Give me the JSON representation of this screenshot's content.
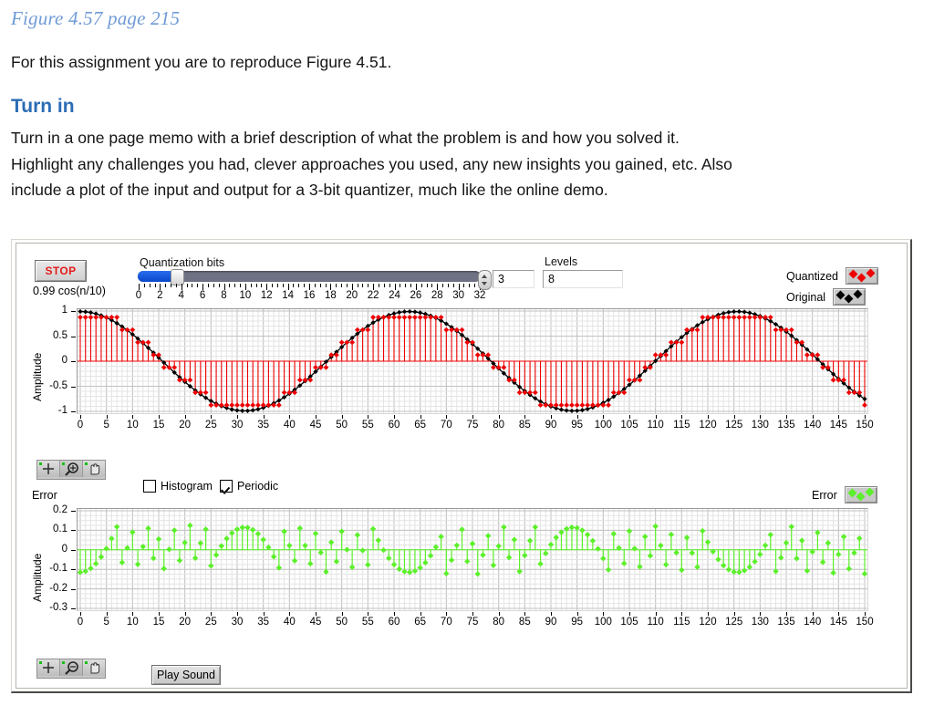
{
  "document": {
    "figure_title": "Figure 4.57 page 215",
    "intro": "For this assignment you are to reproduce Figure 4.51.",
    "section_heading": "Turn in",
    "body_line_1": "Turn in a one page memo with a brief description of what the problem is and how you solved it.",
    "body_line_2": "Highlight any challenges you had, clever approaches you used, any new insights you gained, etc.  Also",
    "body_line_3": "include a plot of the input and output for a 3-bit quantizer, much like the online demo."
  },
  "panel": {
    "stop_label": "STOP",
    "equation_label": "0.99 cos(n/10)",
    "slider": {
      "label": "Quantization bits",
      "value": 3,
      "min": 0,
      "max": 32,
      "tick_labels": [
        "0",
        "2",
        "4",
        "6",
        "8",
        "10",
        "12",
        "14",
        "16",
        "18",
        "20",
        "22",
        "24",
        "26",
        "28",
        "30",
        "32"
      ]
    },
    "bits_field": {
      "value": "3"
    },
    "levels": {
      "label": "Levels",
      "value": "8"
    },
    "legend_top": [
      {
        "name": "Quantized",
        "color": "#ee0000"
      },
      {
        "name": "Original",
        "color": "#000000"
      }
    ],
    "legend_error": {
      "name": "Error",
      "color": "#5bf029"
    },
    "error_title": "Error",
    "checkboxes": [
      {
        "label": "Histogram",
        "checked": false
      },
      {
        "label": "Periodic",
        "checked": true
      }
    ],
    "palette_tools": [
      "cursor-crosshair-tool",
      "zoom-magnifier-tool",
      "pan-hand-tool"
    ],
    "play_sound_label": "Play Sound"
  },
  "chart_data": [
    {
      "id": "signal-plot",
      "type": "line",
      "title": "",
      "xlabel": "",
      "ylabel": "Amplitude",
      "xlim": [
        0,
        150
      ],
      "ylim": [
        -1,
        1
      ],
      "grid": true,
      "xticks": [
        0,
        5,
        10,
        15,
        20,
        25,
        30,
        35,
        40,
        45,
        50,
        55,
        60,
        65,
        70,
        75,
        80,
        85,
        90,
        95,
        100,
        105,
        110,
        115,
        120,
        125,
        130,
        135,
        140,
        145,
        150
      ],
      "yticks": [
        -1,
        -0.5,
        0,
        0.5,
        1
      ],
      "ytick_labels": [
        "-1",
        "-0.5",
        "0",
        "0.5",
        "1"
      ],
      "legend_position": "top-right",
      "series": [
        {
          "name": "Original",
          "color": "#000000",
          "marker": "diamond",
          "formula": "0.99*cos(n/10)",
          "n_points": 151,
          "style": "markers+line"
        },
        {
          "name": "Quantized",
          "color": "#ee0000",
          "marker": "diamond",
          "formula": "quantize(0.99*cos(n/10), 3 bits, 8 levels)",
          "n_points": 151,
          "levels": 8,
          "step": 0.25,
          "style": "stem"
        }
      ]
    },
    {
      "id": "error-plot",
      "type": "scatter",
      "title": "Error",
      "xlabel": "",
      "ylabel": "Amplitude",
      "xlim": [
        0,
        150
      ],
      "ylim": [
        -0.3,
        0.2
      ],
      "grid": true,
      "xticks": [
        0,
        5,
        10,
        15,
        20,
        25,
        30,
        35,
        40,
        45,
        50,
        55,
        60,
        65,
        70,
        75,
        80,
        85,
        90,
        95,
        100,
        105,
        110,
        115,
        120,
        125,
        130,
        135,
        140,
        145,
        150
      ],
      "yticks": [
        0.2,
        0.1,
        0,
        -0.1,
        -0.2,
        -0.3
      ],
      "ytick_labels": [
        "0.2",
        "0.1",
        "0",
        "-0.1",
        "-0.2",
        "-0.3"
      ],
      "legend_position": "top-right",
      "series": [
        {
          "name": "Error",
          "color": "#5bf029",
          "marker": "diamond",
          "formula": "quantized - original",
          "n_points": 151,
          "style": "stem"
        }
      ]
    }
  ]
}
